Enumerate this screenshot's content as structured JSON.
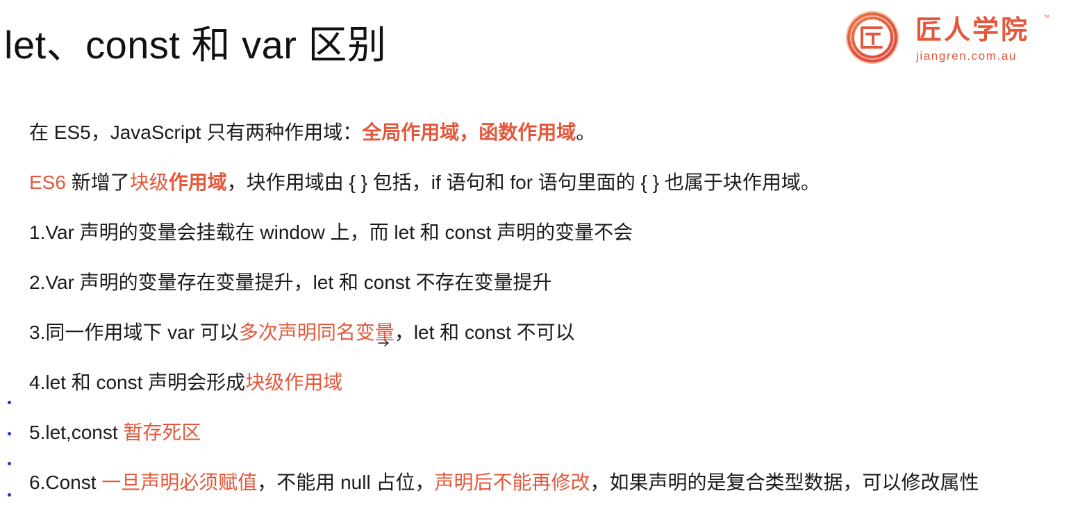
{
  "title": "let、const 和 var 区别",
  "logo": {
    "name": "匠人学院",
    "url": "jiangren.com.au",
    "tm": "™",
    "icon": "jr-logo-icon"
  },
  "lines": [
    {
      "pre": "在 ES5，JavaScript 只有两种作用域：",
      "hl": "全局作用域，函数作用域",
      "post": "。"
    },
    {
      "a": "ES6",
      "b": " 新增了",
      "c": "块级",
      "d": "作用域",
      "e": "，块作用域由 { } 包括，if 语句和 for 语句里面的 { } 也属于块作用域。"
    },
    {
      "text": "1.Var 声明的变量会挂载在 window 上，而 let 和 const 声明的变量不会"
    },
    {
      "text": "2.Var 声明的变量存在变量提升，let 和 const 不存在变量提升"
    },
    {
      "pre": "3.同一作用域下 var 可以",
      "hl": "多次声明同名变量",
      "post": "，let 和 const 不可以"
    },
    {
      "pre": "4.let 和 const 声明会形成",
      "hl": "块级作用域"
    },
    {
      "pre": "5.let,const ",
      "hl": "暂存死区"
    },
    {
      "a": "6.Const ",
      "b": "一旦声明必须赋值",
      "c": "，不能用 null 占位，",
      "d": "声明后不能再修改",
      "e": "，如果声明的是复合类型数据，可以修改属性"
    }
  ],
  "colors": {
    "accent": "#e4573a",
    "text": "#1a1a1a",
    "bullet": "#2233cc"
  }
}
